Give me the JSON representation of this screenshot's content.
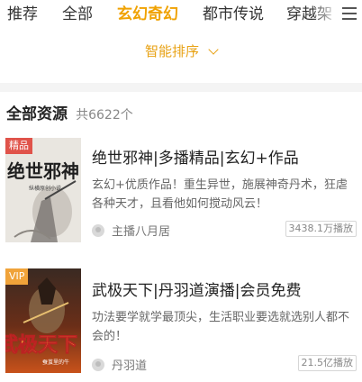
{
  "tabs": [
    "推荐",
    "全部",
    "玄幻奇幻",
    "都市传说",
    "穿越架"
  ],
  "active_tab": "玄幻奇幻",
  "sort": {
    "label": "智能排序"
  },
  "section": {
    "title": "全部资源",
    "count": "共6622个"
  },
  "books": [
    {
      "badge": "精品",
      "badge_color": "#e0534a",
      "cover_text": "绝世邪神",
      "cover_sub": "纵横原创小说",
      "title": "绝世邪神|多播精品|玄幻+作品",
      "desc": "玄幻+优质作品！重生异世，施展神奇丹术，狂虐各种天才，且看他如何搅动风云！",
      "anchor": "主播八月居",
      "plays": "3438.1万播放"
    },
    {
      "badge": "VIP",
      "badge_color": "#f0a33a",
      "cover_text": "武极天下",
      "cover_sub": "蚕茧里的牛",
      "title": "武极天下|丹羽道演播|会员免费",
      "desc": "功法要学就学最顶尖，生活职业要选就选别人都不会的！",
      "anchor": "丹羽道",
      "plays": "21.5亿播放"
    }
  ]
}
